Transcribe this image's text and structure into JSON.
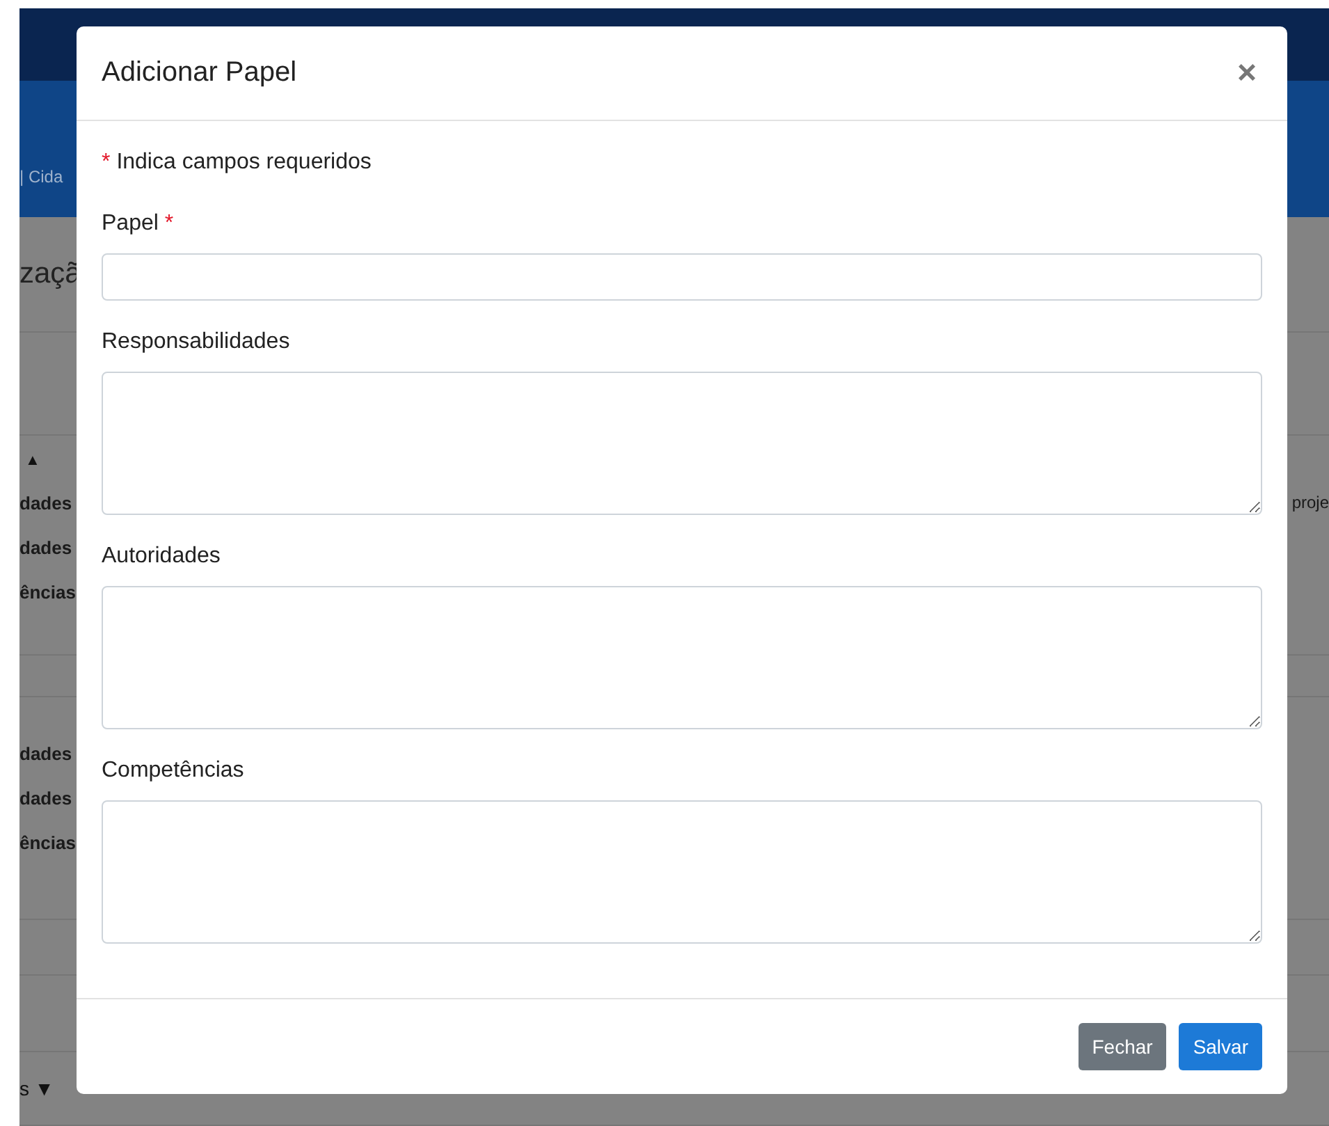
{
  "background": {
    "header_text": "| Cida",
    "page_title": "zaçã",
    "sections": [
      {
        "toggle": "▲",
        "rows": [
          {
            "label": "dades",
            "side_text": "proje"
          },
          {
            "label": "dades"
          },
          {
            "label": "ências"
          }
        ]
      },
      {
        "rows": [
          {
            "label": "dades"
          },
          {
            "label": "dades"
          },
          {
            "label": "ências"
          }
        ]
      }
    ],
    "footer_toggle": "s ▼"
  },
  "modal": {
    "title": "Adicionar Papel",
    "close": "×",
    "required_note": {
      "mark": "*",
      "text": "Indica campos requeridos"
    },
    "fields": [
      {
        "label": "Papel",
        "required": true,
        "required_mark": "*",
        "kind": "input"
      },
      {
        "label": "Responsabilidades",
        "required": false,
        "kind": "textarea"
      },
      {
        "label": "Autoridades",
        "required": false,
        "kind": "textarea"
      },
      {
        "label": "Competências",
        "required": false,
        "kind": "textarea"
      }
    ],
    "buttons": [
      {
        "label": "Fechar",
        "kind": "secondary"
      },
      {
        "label": "Salvar",
        "kind": "primary"
      }
    ]
  }
}
